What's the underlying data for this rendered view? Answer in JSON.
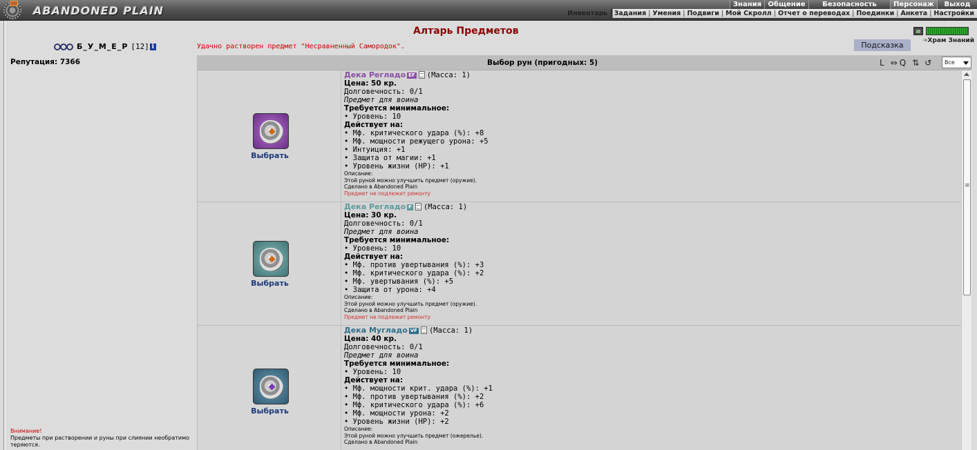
{
  "header": {
    "logo_text": "ABANDONED PLAIN",
    "top_nav": [
      "Знания",
      "Общение",
      "Безопасность",
      "Персонаж",
      "Выход"
    ],
    "sub_nav": [
      "Инвентарь",
      "Задания",
      "Умения",
      "Подвиги",
      "Мой Скролл",
      "Отчет о переводах",
      "Поединки",
      "Анкета",
      "Настройки"
    ]
  },
  "user": {
    "name": "Б_У_М_Е_Р",
    "level": "[12]",
    "info": "i",
    "reputation": "Репутация: 7366"
  },
  "warning": {
    "title": "Внимание!",
    "text": "Предметы при растворении и руны при слиянии необратимо теряются."
  },
  "page": {
    "title": "Алтарь Предметов",
    "message": "Удачно растворен предмет \"Несравненный Самородок\".",
    "hint_button": "Подсказка",
    "temple_label": "Храм Знаний",
    "temple_arrow": "➔"
  },
  "runes_panel": {
    "title": "Выбор рун (пригодных: 5)",
    "tools": [
      "L",
      "⇔",
      "Q",
      "⇅",
      "↺"
    ],
    "filter_value": "Все",
    "colors": {
      "ef": "#8a4fa6",
      "f": "#5f9a9a",
      "vf": "#2f6f8a",
      "red": "#cc0000",
      "title": "#8b0000"
    },
    "items": [
      {
        "name": "Дека Регладо",
        "badge": "EF",
        "mass": "(Масса: 1)",
        "price": "Цена: 50 кр.",
        "durability": "Долговечность: 0/1",
        "type": "Предмет для воина",
        "req_title": "Требуется минимальное:",
        "reqs": [
          "• Уровень: 10"
        ],
        "effects_title": "Действует на:",
        "effects": [
          "• Мф. критического удара (%): +8",
          "• Мф. мощности режущего урона: +5",
          "• Интуиция: +1",
          "• Защита от магии: +1",
          "• Уровень жизни (HP): +1"
        ],
        "desc_title": "Описание:",
        "desc": "Этой руной можно улучшить предмет (оружие).",
        "made": "Сделано в Abandoned Plain",
        "repair": "Предмет не подлежит ремонту",
        "select": "Выбрать"
      },
      {
        "name": "Дека Регладо",
        "badge": "F",
        "mass": "(Масса: 1)",
        "price": "Цена: 30 кр.",
        "durability": "Долговечность: 0/1",
        "type": "Предмет для воина",
        "req_title": "Требуется минимальное:",
        "reqs": [
          "• Уровень: 10"
        ],
        "effects_title": "Действует на:",
        "effects": [
          "• Мф. против увертывания (%): +3",
          "• Мф. критического удара (%): +2",
          "• Мф. увертывания (%): +5",
          "• Защита от урона: +4"
        ],
        "desc_title": "Описание:",
        "desc": "Этой руной можно улучшить предмет (оружие).",
        "made": "Сделано в Abandoned Plain",
        "repair": "Предмет не подлежит ремонту",
        "select": "Выбрать"
      },
      {
        "name": "Дека Мугладо",
        "badge": "VF",
        "mass": "(Масса: 1)",
        "price": "Цена: 40 кр.",
        "durability": "Долговечность: 0/1",
        "type": "Предмет для воина",
        "req_title": "Требуется минимальное:",
        "reqs": [
          "• Уровень: 10"
        ],
        "effects_title": "Действует на:",
        "effects": [
          "• Мф. мощности крит. удара (%): +1",
          "• Мф. против увертывания (%): +2",
          "• Мф. критического удара (%): +6",
          "• Мф. мощности урона: +2",
          "• Уровень жизни (HP): +2"
        ],
        "desc_title": "Описание:",
        "desc": "Этой руной можно улучшить предмет (ожерелье).",
        "made": "Сделано в Abandoned Plain",
        "repair": "",
        "select": "Выбрать"
      }
    ]
  }
}
